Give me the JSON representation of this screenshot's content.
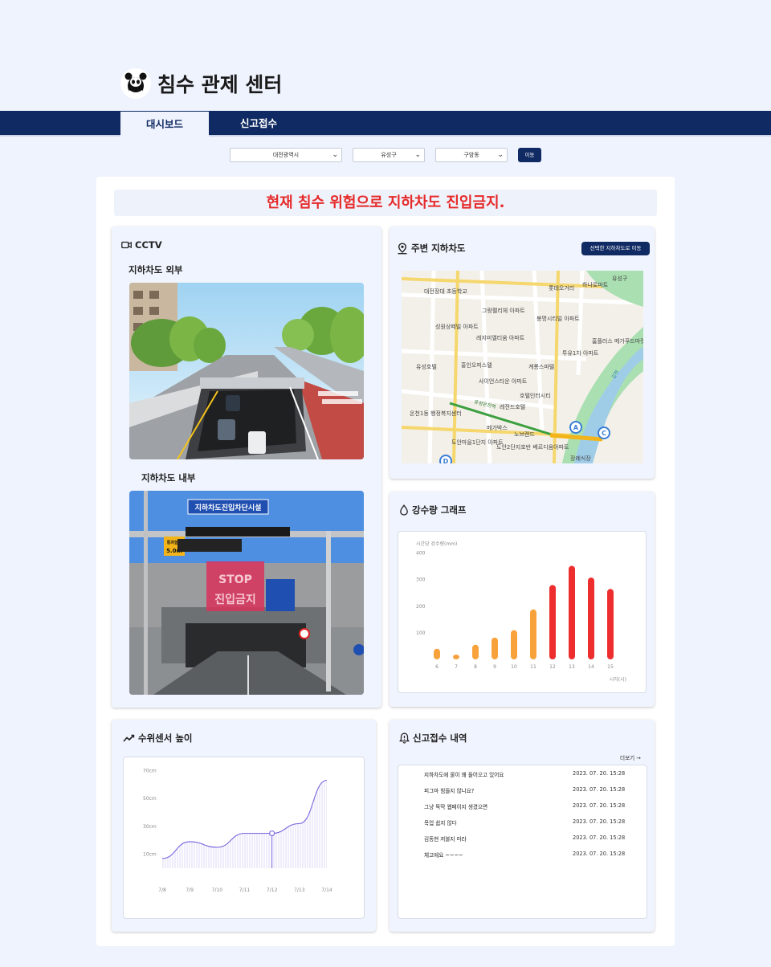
{
  "app": {
    "title": "침수 관제 센터",
    "logo_icon": "panda-logo-icon"
  },
  "nav": {
    "tabs": [
      {
        "label": "대시보드",
        "active": true
      },
      {
        "label": "신고접수",
        "active": false
      }
    ]
  },
  "filters": {
    "city": "대전광역시",
    "district": "유성구",
    "dong": "구암동",
    "go_label": "이동"
  },
  "alert": {
    "message": "현재 침수 위험으로 지하차도 진입금지.",
    "color": "#e62a2a"
  },
  "cctv": {
    "title": "CCTV",
    "outside_label": "지하차도 외부",
    "inside_label": "지하차도 내부",
    "inside_sign": "지하차도진입차단시설",
    "height_limit_label": "통과높이",
    "height_limit_value": "5.0m",
    "stop_sign": "STOP",
    "no_entry_sign": "진입금지"
  },
  "map_card": {
    "title": "주변 지하차도",
    "button_label": "선택한 지하차도로 이동",
    "places": [
      "대전장대 초등학교",
      "유성구",
      "하나로마트",
      "롯데오거리",
      "그랑펠리체 아파트",
      "봉명시티빌 아파트",
      "성원상떼빌 아파트",
      "레지미엘티움 아파트",
      "홈플러스 메가푸드마켓",
      "투유1차 아파트",
      "유성호텔",
      "홍인오피스텔",
      "계룡스파텔",
      "사이언스타운 아파트",
      "호텔인터시티",
      "레전드호텔",
      "온천1동 행정복지센터",
      "메가박스",
      "노브랜드",
      "도안마을1단지 아파트",
      "도안2단지호반 베르디움아파트",
      "장례식장",
      "유성온천역",
      "갑천"
    ],
    "markers": [
      "A",
      "C",
      "D"
    ]
  },
  "rain_card": {
    "title": "강수량 그래프",
    "chart_data": {
      "type": "bar",
      "ylabel": "시간당 강수량(mm)",
      "xlabel": "시각(시)",
      "categories": [
        "6",
        "7",
        "8",
        "9",
        "10",
        "11",
        "12",
        "13",
        "14",
        "15"
      ],
      "values": [
        40,
        18,
        55,
        82,
        110,
        188,
        280,
        352,
        308,
        265
      ],
      "yticks": [
        100,
        200,
        300,
        400
      ],
      "ylim": [
        0,
        420
      ],
      "colors": [
        "#f8a23b",
        "#f8a23b",
        "#f8a23b",
        "#f8a23b",
        "#f8a23b",
        "#f8a23b",
        "#ee2e2e",
        "#ee2e2e",
        "#ee2e2e",
        "#ee2e2e"
      ]
    }
  },
  "water_card": {
    "title": "수위센서 높이",
    "chart_data": {
      "type": "area",
      "categories": [
        "7/8",
        "7/9",
        "7/10",
        "7/11",
        "7/12",
        "7/13",
        "7/14"
      ],
      "values": [
        7,
        19,
        15,
        25,
        25,
        32,
        63
      ],
      "yticks": [
        "10cm",
        "30cm",
        "50cm",
        "70cm"
      ],
      "ylim": [
        0,
        76
      ],
      "color": "#8070e0",
      "highlighted": "7/12"
    }
  },
  "reports": {
    "title": "신고접수 내역",
    "more_label": "더보기",
    "items": [
      {
        "text": "지하차도에 물이 꽤 들어오고 있어요",
        "date": "2023. 07. 20. 15:28"
      },
      {
        "text": "피그마 힘들지 않니요?",
        "date": "2023. 07. 20. 15:28"
      },
      {
        "text": "그냥 뚝딱 웹페이지 생겼으면",
        "date": "2023. 07. 20. 15:28"
      },
      {
        "text": "목업 쉽지 않다",
        "date": "2023. 07. 20. 15:28"
      },
      {
        "text": "김동현 저볼지 마라",
        "date": "2023. 07. 20. 15:28"
      },
      {
        "text": "체고에요 ~~~~",
        "date": "2023. 07. 20. 15:28"
      }
    ]
  }
}
